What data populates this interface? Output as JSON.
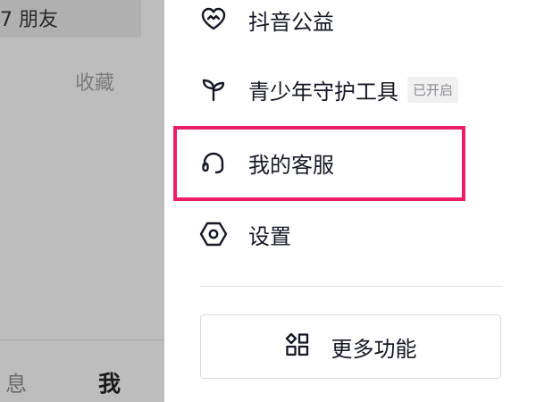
{
  "background": {
    "friends_text": "7 朋友",
    "favorites_tab": "收藏",
    "tab_messages": "息",
    "tab_me": "我"
  },
  "drawer": {
    "items": [
      {
        "label": "抖音公益",
        "icon": "charity-heart-icon"
      },
      {
        "label": "青少年守护工具",
        "icon": "sprout-icon",
        "badge": "已开启"
      },
      {
        "label": "我的客服",
        "icon": "headset-icon",
        "highlighted": true
      },
      {
        "label": "设置",
        "icon": "gear-hexagon-icon"
      }
    ],
    "more_button": {
      "label": "更多功能",
      "icon": "grid-apps-icon"
    }
  },
  "colors": {
    "highlight": "#ee1d6a",
    "text": "#161823",
    "backdrop": "#bdbdbd"
  }
}
